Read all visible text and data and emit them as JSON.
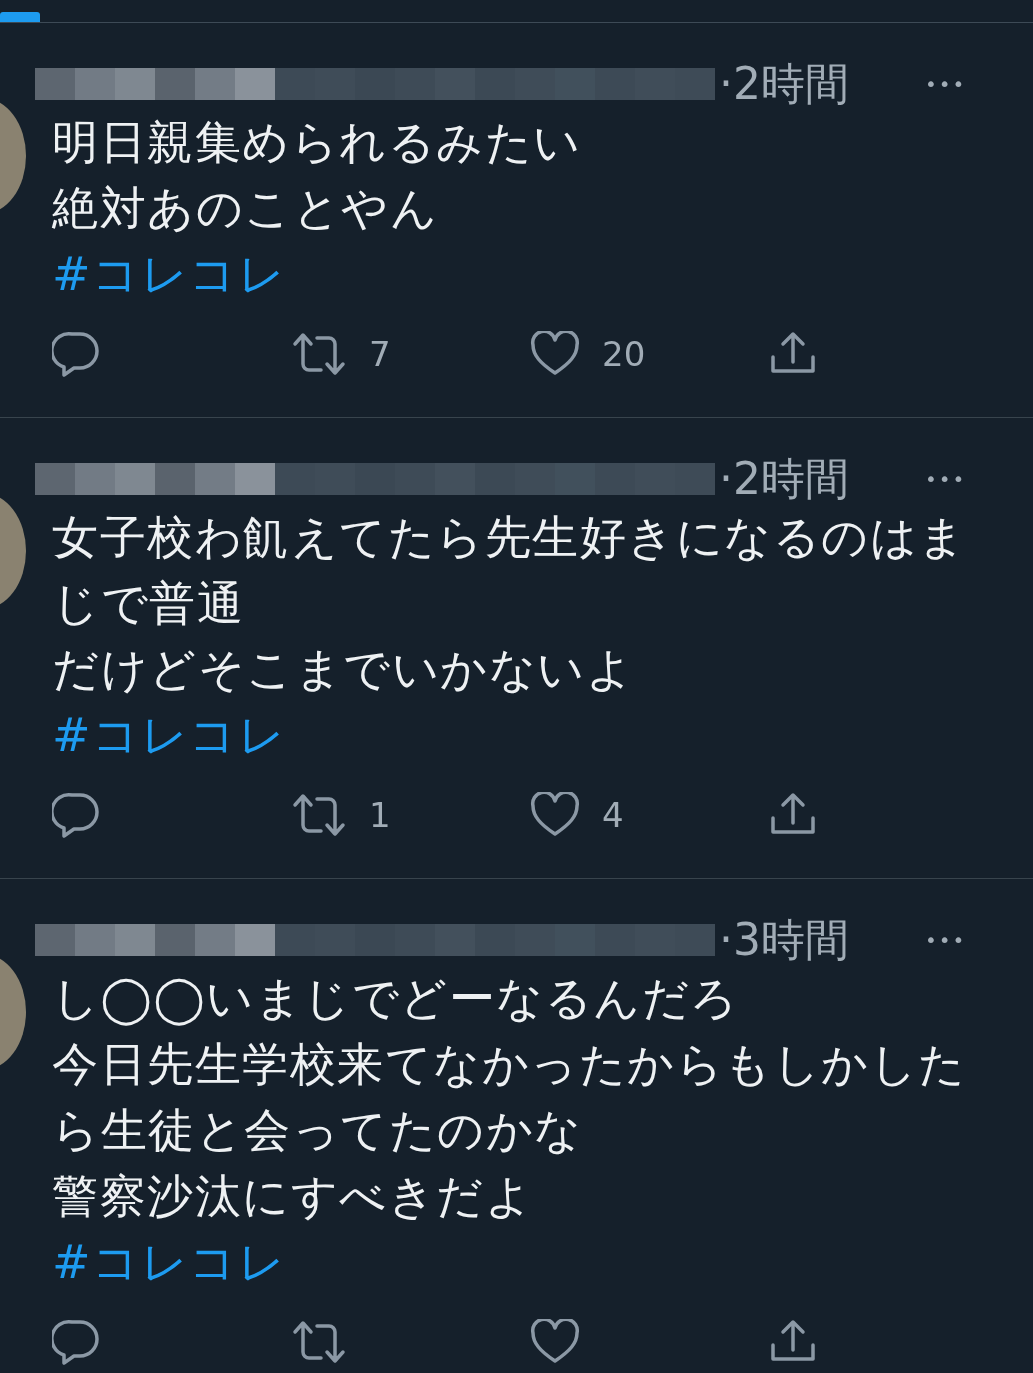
{
  "tweets": [
    {
      "time": "·2時間",
      "menu": "•••",
      "lines": [
        "明日親集められるみたい",
        "絶対あのことやん"
      ],
      "hashtag": "#コレコレ",
      "retweets": "7",
      "likes": "20"
    },
    {
      "time": "·2時間",
      "menu": "•••",
      "lines": [
        "女子校わ飢えてたら先生好きになるのはまじで普通",
        "だけどそこまでいかないよ"
      ],
      "hashtag": "#コレコレ",
      "retweets": "1",
      "likes": "4"
    },
    {
      "time": "·3時間",
      "menu": "•••",
      "lines": [
        "し◯◯いまじでどーなるんだろ",
        "今日先生学校来てなかったからもしかしたら生徒と会ってたのかな",
        "警察沙汰にすべきだよ"
      ],
      "hashtag": "#コレコレ"
    }
  ]
}
